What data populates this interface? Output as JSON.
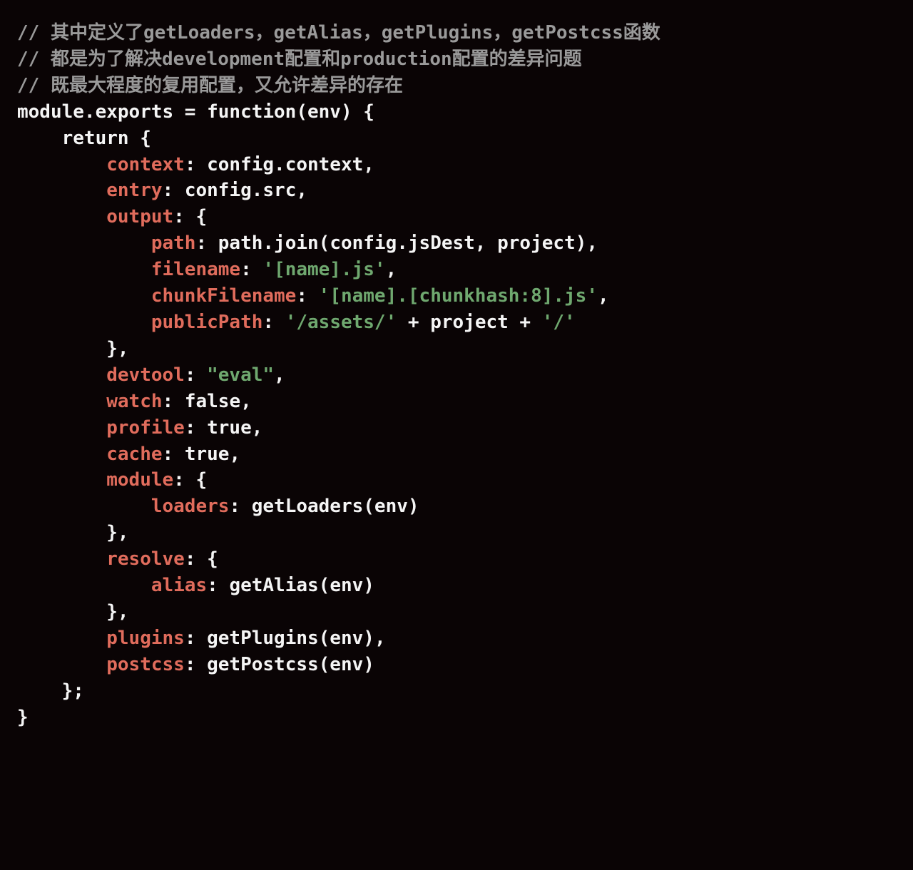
{
  "code": {
    "comment1": "// 其中定义了getLoaders，getAlias，getPlugins，getPostcss函数",
    "comment2": "// 都是为了解决development配置和production配置的差异问题",
    "comment3": "// 既最大程度的复用配置，又允许差异的存在",
    "line_module": "module.exports = ",
    "kw_function": "function",
    "fn_params": "(env) {",
    "kw_return": "return",
    "open_brace": " {",
    "prop_context": "context",
    "val_context": "config.context",
    "prop_entry": "entry",
    "val_entry": "config.src",
    "prop_output": "output",
    "output_open": ": {",
    "prop_path": "path",
    "val_path": "path.join(config.jsDest, project)",
    "prop_filename": "filename",
    "val_filename": "'[name].js'",
    "prop_chunkFilename": "chunkFilename",
    "val_chunkFilename": "'[name].[chunkhash:8].js'",
    "prop_publicPath": "publicPath",
    "val_publicPath_s1": "'/assets/'",
    "val_publicPath_mid": " + project + ",
    "val_publicPath_s2": "'/'",
    "close_output": "},",
    "prop_devtool": "devtool",
    "val_devtool": "\"eval\"",
    "prop_watch": "watch",
    "val_watch": "false",
    "prop_profile": "profile",
    "val_profile": "true",
    "prop_cache": "cache",
    "val_cache": "true",
    "prop_module": "module",
    "module_open": ": {",
    "prop_loaders": "loaders",
    "val_loaders": "getLoaders(env)",
    "close_module": "},",
    "prop_resolve": "resolve",
    "resolve_open": ": {",
    "prop_alias": "alias",
    "val_alias": "getAlias(env)",
    "close_resolve": "},",
    "prop_plugins": "plugins",
    "val_plugins": "getPlugins(env)",
    "prop_postcss": "postcss",
    "val_postcss": "getPostcss(env)",
    "close_return": "};",
    "close_fn": "}"
  }
}
